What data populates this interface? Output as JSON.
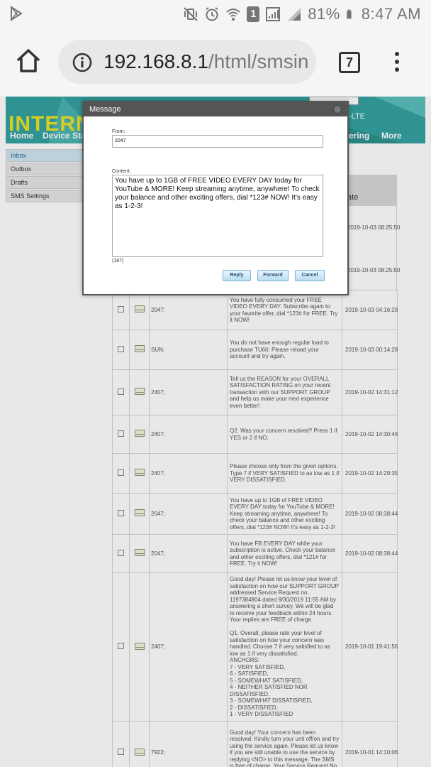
{
  "status_bar": {
    "battery": "81%",
    "time": "8:47 AM",
    "sim_badge": "1",
    "icons": [
      "play-store-icon",
      "mute-vibrate-icon",
      "alarm-icon",
      "wifi-icon",
      "sim-icon",
      "signal-icon",
      "signal-icon-2",
      "battery-icon"
    ]
  },
  "browser": {
    "url_host": "192.168.8.1",
    "url_path": "/html/smsinb",
    "tab_count": "7"
  },
  "router_page": {
    "brand": "INTERNE",
    "nav": {
      "home": "Home",
      "device": "Device Stat",
      "sharing": "ering",
      "more": "More"
    },
    "lte": "-LTE",
    "sidebar": [
      "Inbox",
      "Outbox",
      "Drafts",
      "SMS Settings"
    ],
    "date_header": "ate",
    "upper_dates": [
      "2019-10-03 08:25:50",
      "2019-10-03 08:25:50"
    ],
    "messages": [
      {
        "phone": "2047;",
        "content": "You have fully consumed your FREE VIDEO EVERY DAY. Subscribe again to your favorite offer, dial *123# for FREE. Try it NOW!",
        "date": "2019-10-03 04:16:28"
      },
      {
        "phone": "SUN;",
        "content": "You do not have enough regular load to purchase TU60. Please reload your account and try again.",
        "date": "2019-10-03 00:14:28"
      },
      {
        "phone": "2407;",
        "content": "Tell us the REASON for your OVERALL SATISFACTION RATING on your recent transaction with our SUPPORT GROUP and help us make your next experience even better!",
        "date": "2019-10-02 14:31:12"
      },
      {
        "phone": "2407;",
        "content": "Q2. Was your concern resolved? Press 1 if YES or 2 if NO.",
        "date": "2019-10-02 14:30:46"
      },
      {
        "phone": "2407;",
        "content": "Please choose only from the given options. Type 7 if VERY SATISFIED to as low as 1 if VERY DISSATISFIED.",
        "date": "2019-10-02 14:29:35"
      },
      {
        "phone": "2047;",
        "content": "You have up to 1GB of FREE VIDEO EVERY DAY today for YouTube & MORE! Keep streaming anytime, anywhere! To check your balance and other exciting offers, dial *123# NOW! It's easy as 1-2-3!",
        "date": "2019-10-02 08:38:44"
      },
      {
        "phone": "2047;",
        "content": "You have FB EVERY DAY while your subscription is active. Check your balance and other exciting offers, dial *121# for FREE. Try it NOW!",
        "date": "2019-10-02 08:38:44"
      },
      {
        "phone": "2407;",
        "content": "Good day! Please let us know your level of satisfaction on how our SUPPORT GROUP addressed Service Request no. 1197384804 dated 9/30/2019 11:55 AM by answering a short survey. We will be glad to receive your feedback within 24 hours. Your replies are FREE of charge.\n\nQ1. Overall, please rate your level of satisfaction on how your concern was handled. Choose 7 if very satisfied to as low as 1 if very dissatisfied.\nANCHORS:\n7 - VERY SATISFIED,\n6 - SATISFIED,\n5 - SOMEWHAT SATISFIED,\n4 - NEITHER SATISFIED NOR DISSATISFIED,\n3 - SOMEWHAT DISSATISFIED,\n2 - DISSATISFIED,\n1 - VERY DISSATISFIED",
        "date": "2019-10-01 19:41:56"
      },
      {
        "phone": "7922;",
        "content": "Good day! Your concern has been resolved. Kindly turn your unit off/on and try using the service again. Please let us know if you are still unable to use the service by replying <NO> to this message. The SMS is free of charge. Your Service Request No. is 1197384804. Thank you!",
        "date": "2019-10-01 14:10:06"
      }
    ]
  },
  "modal": {
    "title": "Message",
    "from_label": "From:",
    "from_value": "2047",
    "content_label": "Content:",
    "content_value": "You have up to 1GB of FREE VIDEO EVERY DAY today for YouTube & MORE! Keep streaming anytime, anywhere! To check your balance and other exciting offers, dial *123# NOW! It's easy as 1-2-3!",
    "char_count": "(187)",
    "reply_label": "Reply",
    "forward_label": "Forward",
    "cancel_label": "Cancel"
  }
}
